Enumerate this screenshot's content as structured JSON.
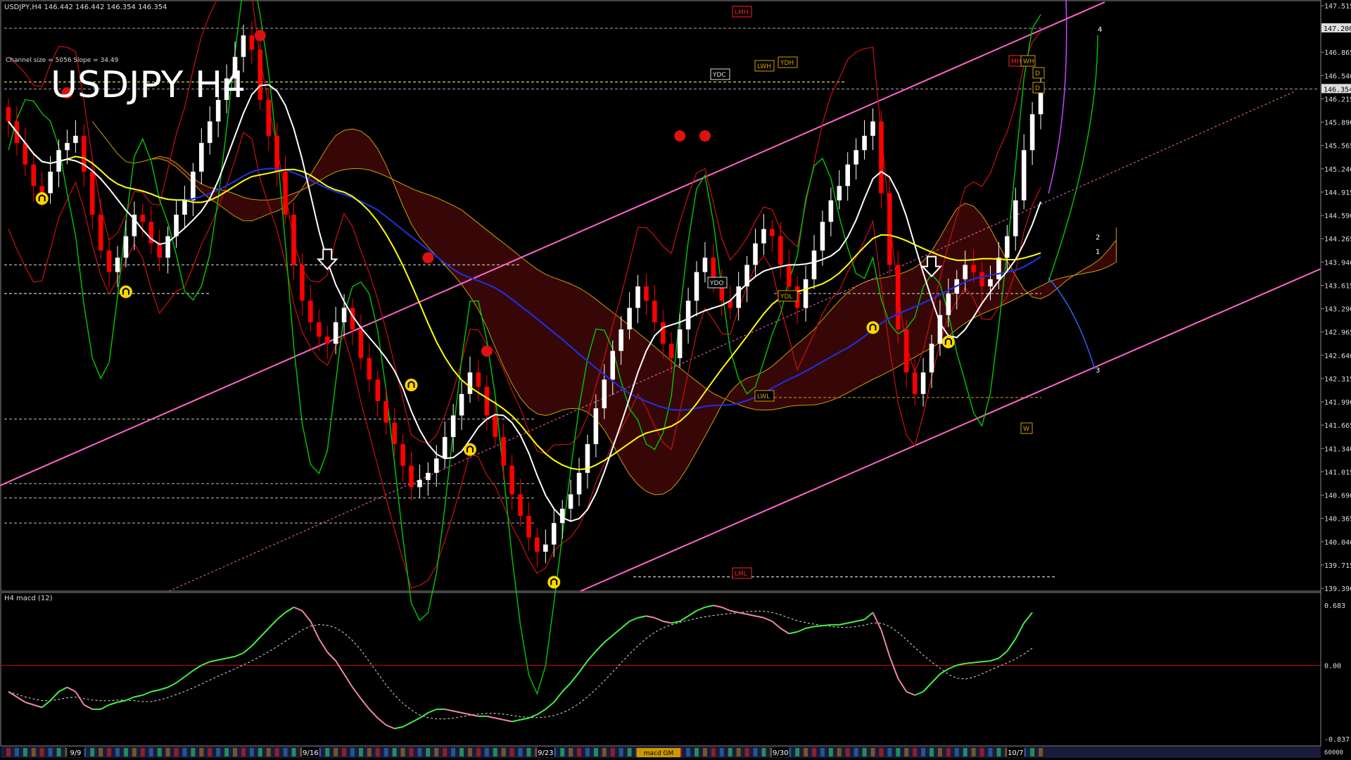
{
  "window": {
    "header_line": "USDJPY,H4  146.442 146.442 146.354 146.354",
    "channel_info": "Channel size = 5056 Slope = 34.49",
    "watermark": "USDJPY H4",
    "macd_title": "H4  macd (12)",
    "bottom_tab": "macd GM"
  },
  "colors": {
    "background": "#000000",
    "bull_candle": "#ffffff",
    "bear_candle": "#ff0000",
    "ma_white": "#ffffff",
    "ma_yellow": "#ffff00",
    "ma_blue": "#1c2fd8",
    "channel": "#ff66cc",
    "osc_green": "#00c800",
    "macd_up": "#44ee44",
    "macd_down": "#ee88aa",
    "level_red": "#ff2222",
    "level_gold": "#d4a000"
  },
  "chart_data": {
    "type": "candlestick",
    "symbol": "USDJPY",
    "timeframe": "H4",
    "last_price": 146.354,
    "ylim": [
      139.39,
      147.515
    ],
    "price_ticks": [
      "147.515",
      "147.190",
      "146.865",
      "146.540",
      "146.215",
      "145.890",
      "145.565",
      "145.240",
      "144.915",
      "144.590",
      "144.265",
      "143.940",
      "143.615",
      "143.290",
      "142.965",
      "142.640",
      "142.315",
      "141.990",
      "141.665",
      "141.340",
      "141.015",
      "140.690",
      "140.365",
      "140.040",
      "139.715",
      "139.390"
    ],
    "highlighted_price_labels": [
      "147.200",
      "146.354"
    ],
    "date_labels": [
      {
        "label": "9/9",
        "bar": 8
      },
      {
        "label": "9/16",
        "bar": 36
      },
      {
        "label": "9/23",
        "bar": 64
      },
      {
        "label": "9/30",
        "bar": 92
      },
      {
        "label": "10/7",
        "bar": 120
      }
    ],
    "closes": [
      145.9,
      145.6,
      145.3,
      145.0,
      144.9,
      145.2,
      145.5,
      145.6,
      145.7,
      145.2,
      144.6,
      144.1,
      143.8,
      144.0,
      144.3,
      144.6,
      144.5,
      144.2,
      144.0,
      144.3,
      144.6,
      144.8,
      145.2,
      145.6,
      145.9,
      146.2,
      146.5,
      146.8,
      147.1,
      146.9,
      146.2,
      145.7,
      145.2,
      144.6,
      143.9,
      143.4,
      143.1,
      142.9,
      142.8,
      143.1,
      143.3,
      143.0,
      142.6,
      142.3,
      142.0,
      141.7,
      141.4,
      141.1,
      140.8,
      140.9,
      141.0,
      141.2,
      141.5,
      141.8,
      142.1,
      142.4,
      142.2,
      141.8,
      141.5,
      141.1,
      140.7,
      140.4,
      140.1,
      139.9,
      140.0,
      140.3,
      140.5,
      140.7,
      141.0,
      141.4,
      141.9,
      142.3,
      142.7,
      143.0,
      143.3,
      143.6,
      143.4,
      143.1,
      142.8,
      142.6,
      143.0,
      143.4,
      143.8,
      144.0,
      143.7,
      143.4,
      143.3,
      143.6,
      143.9,
      144.2,
      144.4,
      144.3,
      143.9,
      143.6,
      143.3,
      143.7,
      144.1,
      144.5,
      144.8,
      145.0,
      145.3,
      145.5,
      145.7,
      145.9,
      144.9,
      143.9,
      143.0,
      142.4,
      142.1,
      142.4,
      142.8,
      143.2,
      143.5,
      143.7,
      143.9,
      143.8,
      143.6,
      143.7,
      144.0,
      144.3,
      144.8,
      145.5,
      146.0,
      146.35
    ],
    "macd": [
      -0.3,
      -0.36,
      -0.42,
      -0.45,
      -0.48,
      -0.4,
      -0.3,
      -0.25,
      -0.3,
      -0.45,
      -0.5,
      -0.5,
      -0.45,
      -0.42,
      -0.4,
      -0.36,
      -0.34,
      -0.3,
      -0.28,
      -0.25,
      -0.2,
      -0.13,
      -0.06,
      0.0,
      0.04,
      0.06,
      0.08,
      0.1,
      0.14,
      0.22,
      0.32,
      0.42,
      0.52,
      0.6,
      0.66,
      0.62,
      0.5,
      0.3,
      0.15,
      0.05,
      -0.1,
      -0.25,
      -0.38,
      -0.5,
      -0.6,
      -0.68,
      -0.72,
      -0.7,
      -0.65,
      -0.6,
      -0.54,
      -0.5,
      -0.5,
      -0.52,
      -0.54,
      -0.56,
      -0.58,
      -0.58,
      -0.6,
      -0.62,
      -0.64,
      -0.62,
      -0.6,
      -0.56,
      -0.5,
      -0.42,
      -0.3,
      -0.2,
      -0.08,
      0.05,
      0.16,
      0.26,
      0.34,
      0.42,
      0.5,
      0.54,
      0.56,
      0.54,
      0.5,
      0.48,
      0.5,
      0.56,
      0.62,
      0.66,
      0.68,
      0.66,
      0.62,
      0.6,
      0.58,
      0.56,
      0.54,
      0.5,
      0.42,
      0.36,
      0.38,
      0.42,
      0.44,
      0.45,
      0.46,
      0.46,
      0.48,
      0.5,
      0.52,
      0.6,
      0.4,
      0.1,
      -0.15,
      -0.3,
      -0.34,
      -0.3,
      -0.2,
      -0.1,
      -0.04,
      0.0,
      0.02,
      0.03,
      0.04,
      0.05,
      0.08,
      0.16,
      0.3,
      0.48,
      0.6
    ],
    "macd_ticks": [
      "0.683",
      "0.00",
      "-0.837"
    ],
    "macd_ylim": [
      -0.837,
      0.683
    ],
    "right_labels": [
      "1",
      "2",
      "3",
      "4"
    ],
    "level_tags": [
      "LMH",
      "LML",
      "YDC",
      "YDH",
      "YDL",
      "YDO",
      "LWH",
      "LWL",
      "MH",
      "WH",
      "W",
      "D",
      "D"
    ],
    "bottom_right_label": "60000"
  }
}
